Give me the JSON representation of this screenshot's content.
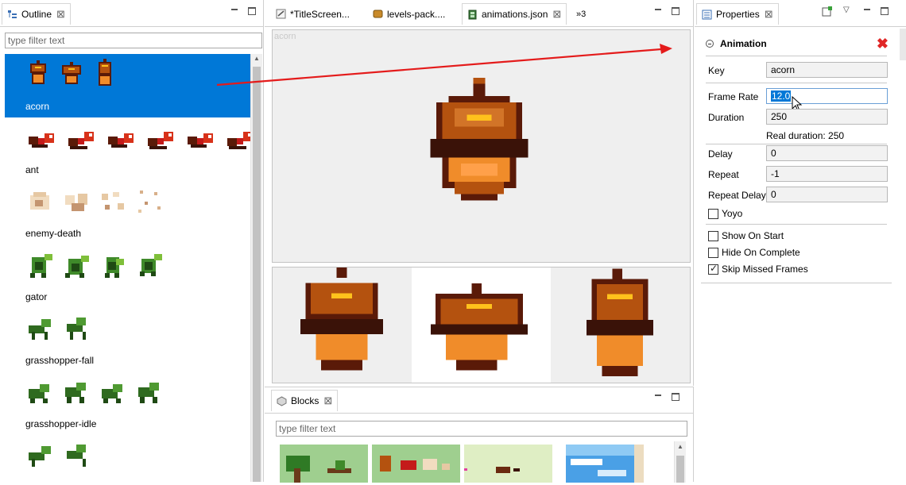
{
  "outline": {
    "title": "Outline",
    "filter_placeholder": "type filter text",
    "items": [
      {
        "label": "acorn",
        "selected": true
      },
      {
        "label": "ant"
      },
      {
        "label": "enemy-death"
      },
      {
        "label": "gator"
      },
      {
        "label": "grasshopper-fall"
      },
      {
        "label": "grasshopper-idle"
      },
      {
        "label": ""
      }
    ]
  },
  "editor": {
    "tabs": [
      {
        "label": "*TitleScreen..."
      },
      {
        "label": "levels-pack...."
      },
      {
        "label": "animations.json",
        "active": true
      },
      {
        "label": "»3"
      }
    ],
    "preview_label": "acorn"
  },
  "blocks": {
    "title": "Blocks",
    "filter_placeholder": "type filter text"
  },
  "properties": {
    "title": "Properties",
    "section_title": "Animation",
    "key_label": "Key",
    "key_value": "acorn",
    "frame_rate_label": "Frame Rate",
    "frame_rate_value": "12.0",
    "duration_label": "Duration",
    "duration_value": "250",
    "real_duration_text": "Real duration: 250",
    "delay_label": "Delay",
    "delay_value": "0",
    "repeat_label": "Repeat",
    "repeat_value": "-1",
    "repeat_delay_label": "Repeat Delay",
    "repeat_delay_value": "0",
    "yoyo_label": "Yoyo",
    "yoyo_checked": false,
    "show_on_start_label": "Show On Start",
    "show_on_start_checked": false,
    "hide_on_complete_label": "Hide On Complete",
    "hide_on_complete_checked": false,
    "skip_missed_frames_label": "Skip Missed Frames",
    "skip_missed_frames_checked": true
  },
  "colors": {
    "selection": "#0078d7",
    "annotation_arrow": "#e41b1b",
    "acorn_dark": "#5a1a08",
    "acorn_mid": "#b4520f",
    "acorn_light": "#f08c2a",
    "acorn_highlight": "#ffc21c",
    "remove_icon": "#e02626"
  }
}
